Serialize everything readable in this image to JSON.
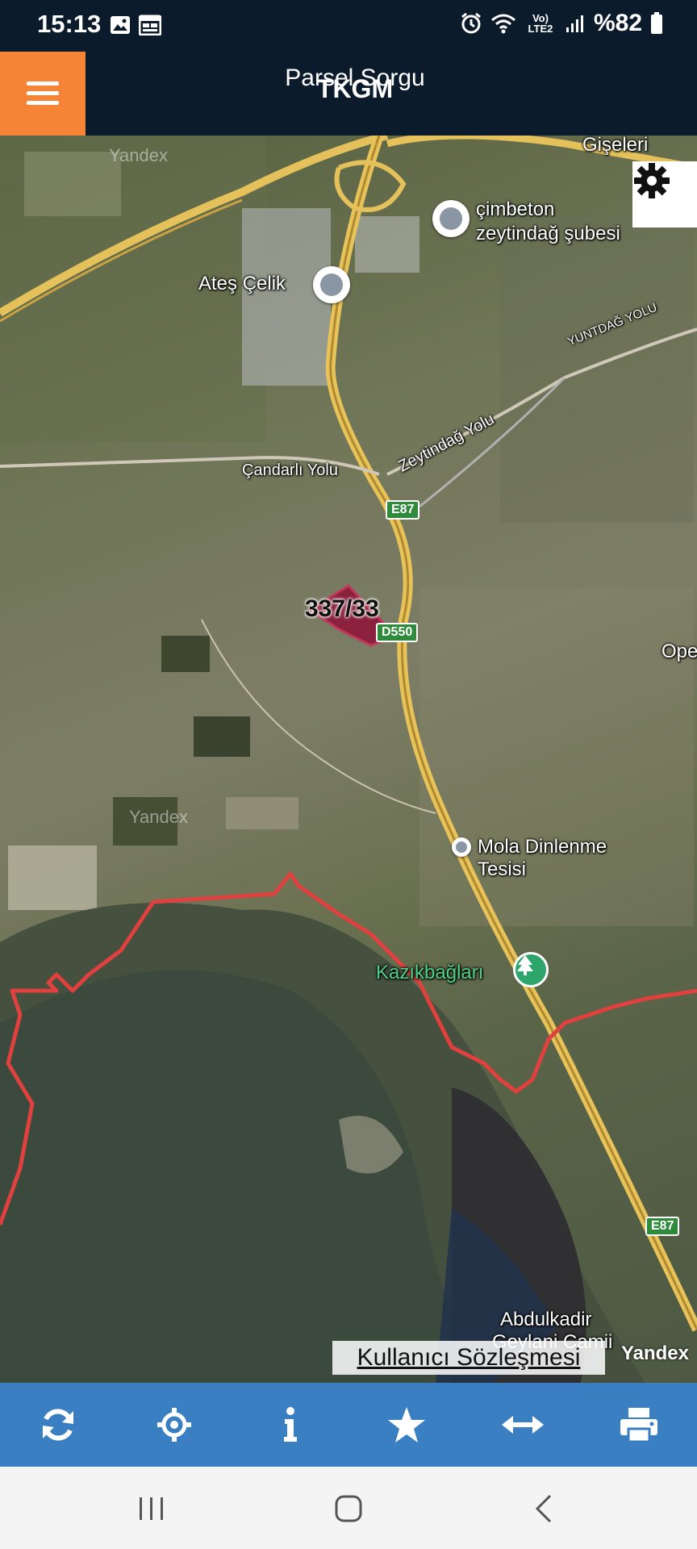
{
  "status_bar": {
    "time": "15:13",
    "battery": "%82",
    "network_label": "Vo) LTE2",
    "icons": [
      "gallery-icon",
      "calendar-icon",
      "alarm-icon",
      "wifi-icon",
      "signal-icon",
      "battery-icon"
    ]
  },
  "header": {
    "title": "TKGM",
    "subtitle": "Parsel Sorgu",
    "menu_icon": "hamburger-menu-icon",
    "accent_color": "#f58436",
    "background_color": "#0c1b2c"
  },
  "map": {
    "parcel_label": "337/33",
    "parcel_color": "#8c1d3c",
    "boundary_color": "#e0403e",
    "labels": {
      "cimbeton": "çimbeton",
      "cimbeton_branch": "zeytindağ şubesi",
      "ates": "Ateş Çelik",
      "zeytindag_yolu": "Zeytindağ Yolu",
      "candarli_yolu": "Çandarlı Yolu",
      "mola": "Mola Dinlenme",
      "mola_2": "Tesisi",
      "kazikbaglari": "Kazıkbağları",
      "abdulkadir": "Abdulkadir",
      "abdulkadir_2": "Geylani Camii",
      "giseleri": "Gişeleri",
      "ope": "Ope",
      "yuntdag": "YUNTDAĞ YOLU"
    },
    "road_shields": [
      "E87",
      "D550",
      "E87"
    ],
    "yandex_watermark": "Yandex",
    "yandex_logo": "Yandex",
    "user_agreement": "Kullanıcı Sözleşmesi",
    "settings_icon": "gear-icon"
  },
  "toolbar": {
    "background_color": "#3a7fc2",
    "items": [
      {
        "name": "refresh-icon"
      },
      {
        "name": "crosshair-location-icon"
      },
      {
        "name": "info-icon"
      },
      {
        "name": "star-favorite-icon"
      },
      {
        "name": "measure-arrows-icon"
      },
      {
        "name": "print-icon"
      }
    ]
  },
  "nav_bar": {
    "items": [
      "recent-apps-icon",
      "home-icon",
      "back-icon"
    ]
  }
}
